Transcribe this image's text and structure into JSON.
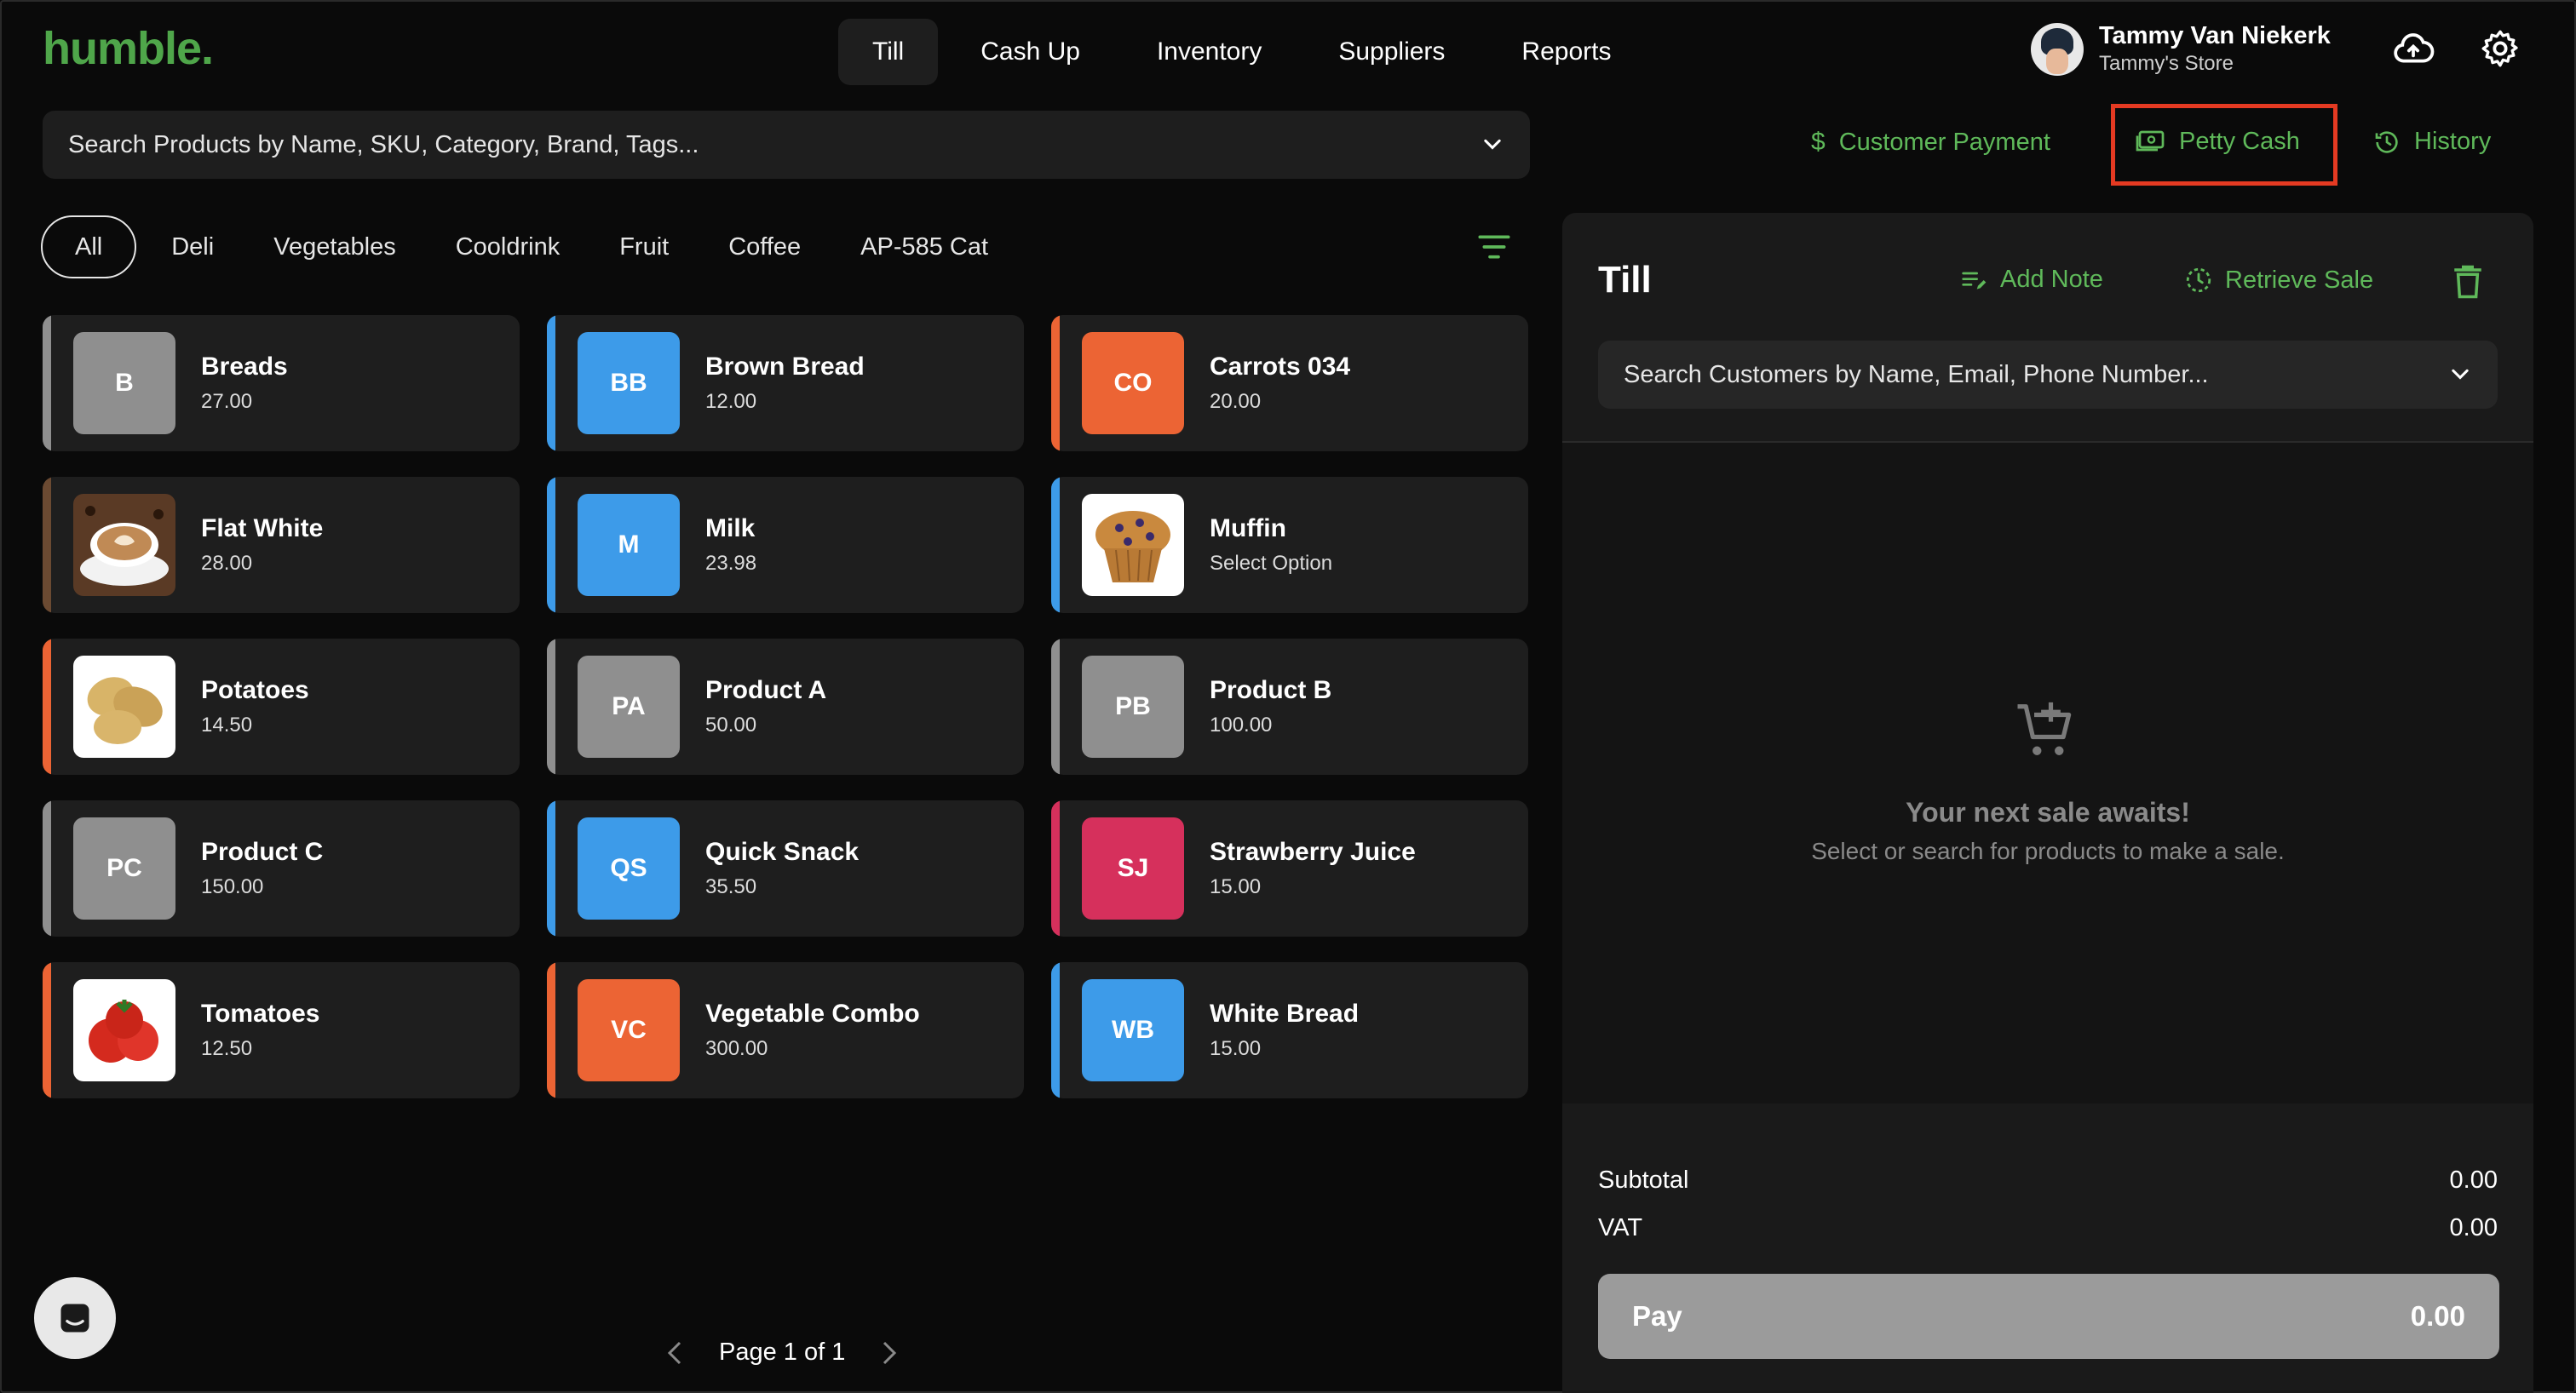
{
  "brand": {
    "logo": "humble."
  },
  "nav": {
    "tabs": [
      "Till",
      "Cash Up",
      "Inventory",
      "Suppliers",
      "Reports"
    ],
    "active": "Till"
  },
  "user": {
    "name": "Tammy Van Niekerk",
    "store": "Tammy's Store"
  },
  "search": {
    "placeholder": "Search Products by Name, SKU, Category, Brand, Tags..."
  },
  "categories": [
    "All",
    "Deli",
    "Vegetables",
    "Cooldrink",
    "Fruit",
    "Coffee",
    "AP-585 Cat"
  ],
  "actions": {
    "customer_payment": "Customer Payment",
    "petty_cash": "Petty Cash",
    "history": "History"
  },
  "products": [
    {
      "name": "Breads",
      "price": "27.00",
      "initials": "B",
      "tile_color": "#8f8f8f",
      "accent": "#8f8f8f"
    },
    {
      "name": "Brown Bread",
      "price": "12.00",
      "initials": "BB",
      "tile_color": "#3d9be9",
      "accent": "#3d9be9"
    },
    {
      "name": "Carrots 034",
      "price": "20.00",
      "initials": "CO",
      "tile_color": "#ec6434",
      "accent": "#ec6434"
    },
    {
      "name": "Flat White",
      "price": "28.00",
      "initials": "",
      "image": "coffee",
      "accent": "#6b4a32"
    },
    {
      "name": "Milk",
      "price": "23.98",
      "initials": "M",
      "tile_color": "#3d9be9",
      "accent": "#3d9be9"
    },
    {
      "name": "Muffin",
      "price": "Select Option",
      "initials": "",
      "image": "muffin",
      "accent": "#3d9be9"
    },
    {
      "name": "Potatoes",
      "price": "14.50",
      "initials": "",
      "image": "potato",
      "accent": "#ec6434"
    },
    {
      "name": "Product A",
      "price": "50.00",
      "initials": "PA",
      "tile_color": "#8f8f8f",
      "accent": "#8f8f8f"
    },
    {
      "name": "Product B",
      "price": "100.00",
      "initials": "PB",
      "tile_color": "#8f8f8f",
      "accent": "#8f8f8f"
    },
    {
      "name": "Product C",
      "price": "150.00",
      "initials": "PC",
      "tile_color": "#8f8f8f",
      "accent": "#8f8f8f"
    },
    {
      "name": "Quick Snack",
      "price": "35.50",
      "initials": "QS",
      "tile_color": "#3d9be9",
      "accent": "#3d9be9"
    },
    {
      "name": "Strawberry Juice",
      "price": "15.00",
      "initials": "SJ",
      "tile_color": "#d6305c",
      "accent": "#d6305c"
    },
    {
      "name": "Tomatoes",
      "price": "12.50",
      "initials": "",
      "image": "tomato",
      "accent": "#ec6434"
    },
    {
      "name": "Vegetable Combo",
      "price": "300.00",
      "initials": "VC",
      "tile_color": "#ec6434",
      "accent": "#ec6434"
    },
    {
      "name": "White Bread",
      "price": "15.00",
      "initials": "WB",
      "tile_color": "#3d9be9",
      "accent": "#3d9be9"
    }
  ],
  "pager": {
    "label": "Page 1 of 1"
  },
  "till": {
    "title": "Till",
    "add_note": "Add Note",
    "retrieve_sale": "Retrieve Sale",
    "customer_search_placeholder": "Search Customers by Name, Email, Phone Number...",
    "empty_title": "Your next sale awaits!",
    "empty_subtitle": "Select or search for products to make a sale.",
    "subtotal_label": "Subtotal",
    "subtotal_value": "0.00",
    "vat_label": "VAT",
    "vat_value": "0.00",
    "pay_label": "Pay",
    "pay_value": "0.00"
  },
  "colors": {
    "accent_green": "#5fb95a",
    "highlight_red": "#e53a22",
    "panel": "#1a1a1a",
    "card": "#1e1e1e"
  }
}
